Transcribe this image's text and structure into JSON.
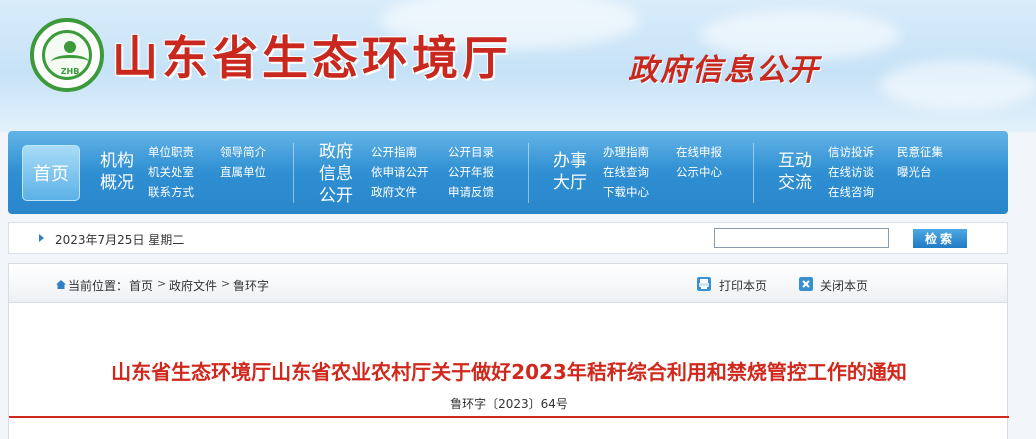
{
  "header": {
    "emblem_text": "ZHB",
    "site_title": "山东省生态环境厅",
    "section_title": "政府信息公开"
  },
  "nav": {
    "home": "首页",
    "groups": [
      {
        "title": [
          "机构",
          "概况"
        ],
        "links": [
          "单位职责",
          "领导简介",
          "机关处室",
          "直属单位",
          "联系方式"
        ]
      },
      {
        "title": [
          "政府",
          "信息",
          "公开"
        ],
        "links": [
          "公开指南",
          "公开目录",
          "依申请公开",
          "公开年报",
          "政府文件",
          "申请反馈"
        ]
      },
      {
        "title": [
          "办事",
          "大厅"
        ],
        "links": [
          "办理指南",
          "在线申报",
          "在线查询",
          "公示中心",
          "下载中心"
        ]
      },
      {
        "title": [
          "互动",
          "交流"
        ],
        "links": [
          "信访投诉",
          "民意征集",
          "在线访谈",
          "曝光台",
          "在线咨询"
        ]
      }
    ]
  },
  "datebar": {
    "date": "2023年7月25日 星期二",
    "search_value": "",
    "search_button": "检索"
  },
  "location": {
    "label": "当前位置：",
    "crumbs": [
      "首页",
      "政府文件",
      "鲁环字"
    ],
    "separator": ">",
    "print": "打印本页",
    "close": "关闭本页"
  },
  "article": {
    "title": "山东省生态环境厅山东省农业农村厅关于做好2023年秸秆综合利用和禁烧管控工作的通知",
    "doc_number": "鲁环字〔2023〕64号"
  },
  "colors": {
    "brand_red": "#d0281c",
    "nav_blue": "#2f8fd2",
    "emblem_green": "#3c9a3a"
  }
}
